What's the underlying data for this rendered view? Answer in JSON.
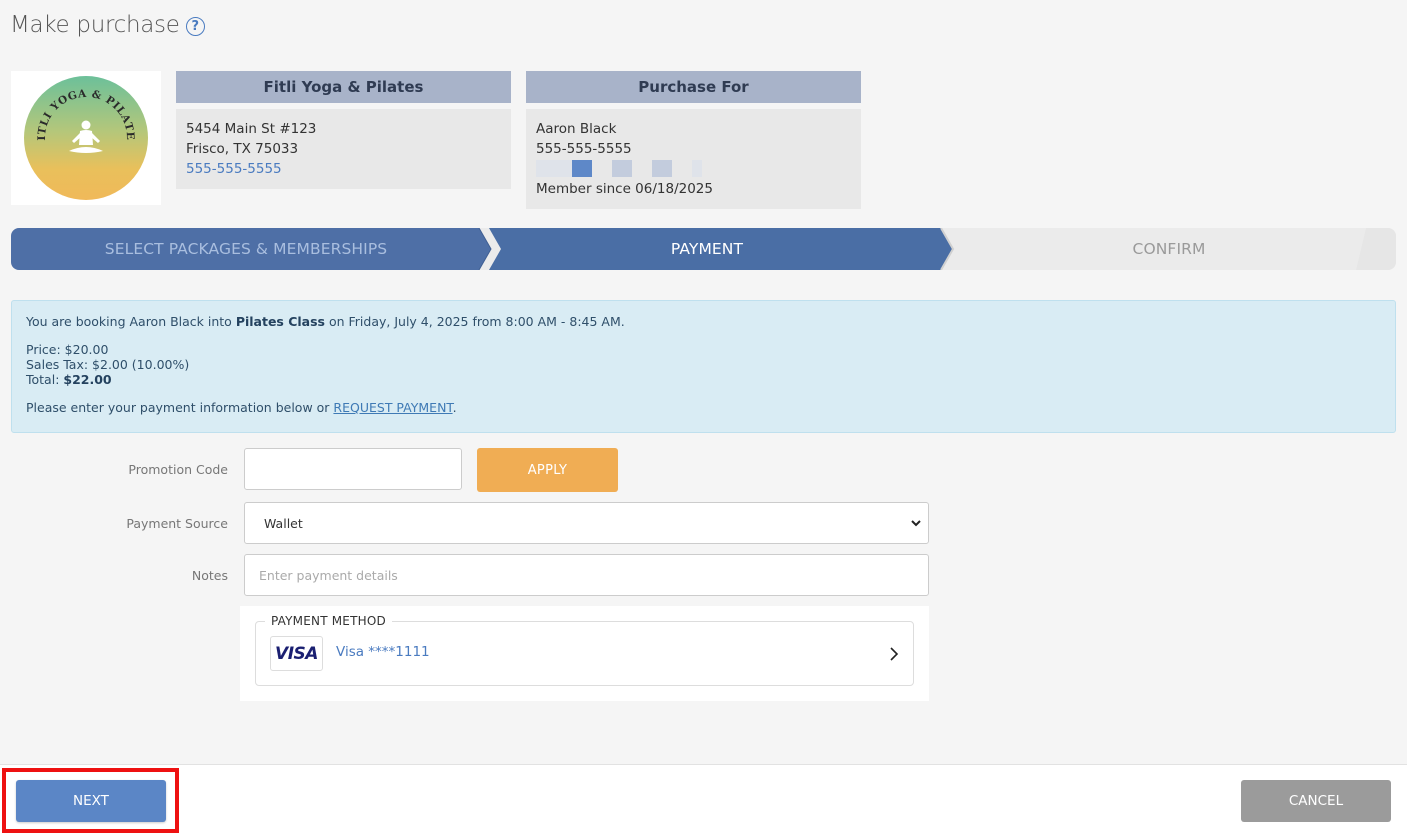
{
  "page": {
    "title": "Make purchase",
    "help_icon": "question-circle-icon"
  },
  "studio": {
    "logo_text": "FITLI YOGA & PILATES",
    "name": "Fitli Yoga & Pilates",
    "address_line1": "5454 Main St #123",
    "address_line2": "Frisco, TX 75033",
    "phone": "555-555-5555"
  },
  "member": {
    "header": "Purchase For",
    "name": "Aaron Black",
    "phone": "555-555-5555",
    "member_since": "Member since 06/18/2025"
  },
  "steps": [
    {
      "label": "SELECT PACKAGES & MEMBERSHIPS",
      "state": "complete"
    },
    {
      "label": "PAYMENT",
      "state": "active"
    },
    {
      "label": "CONFIRM",
      "state": "pending"
    }
  ],
  "booking": {
    "intro_prefix": "You are booking Aaron Black into ",
    "class_name": "Pilates Class",
    "intro_suffix": " on Friday, July 4, 2025 from 8:00 AM - 8:45 AM.",
    "price": "Price: $20.00",
    "sales_tax": "Sales Tax: $2.00 (10.00%)",
    "total_label": "Total: ",
    "total_value": "$22.00",
    "payment_prompt": "Please enter your payment information below or ",
    "request_payment_link": "REQUEST PAYMENT",
    "payment_prompt_end": "."
  },
  "form": {
    "promo_label": "Promotion Code",
    "promo_value": "",
    "apply_label": "APPLY",
    "source_label": "Payment Source",
    "source_value": "Wallet",
    "notes_label": "Notes",
    "notes_placeholder": "Enter payment details"
  },
  "payment_method": {
    "legend": "PAYMENT METHOD",
    "card_brand": "VISA",
    "card_label": "Visa ****1111"
  },
  "footer": {
    "next_label": "NEXT",
    "cancel_label": "CANCEL"
  },
  "colors": {
    "step_active": "#4a6ea5",
    "step_complete": "#4e6fa6",
    "step_pending": "#ebebeb",
    "apply": "#f0ad54",
    "next": "#5b86c6",
    "cancel": "#9b9b9b",
    "highlight": "#ee1111"
  }
}
